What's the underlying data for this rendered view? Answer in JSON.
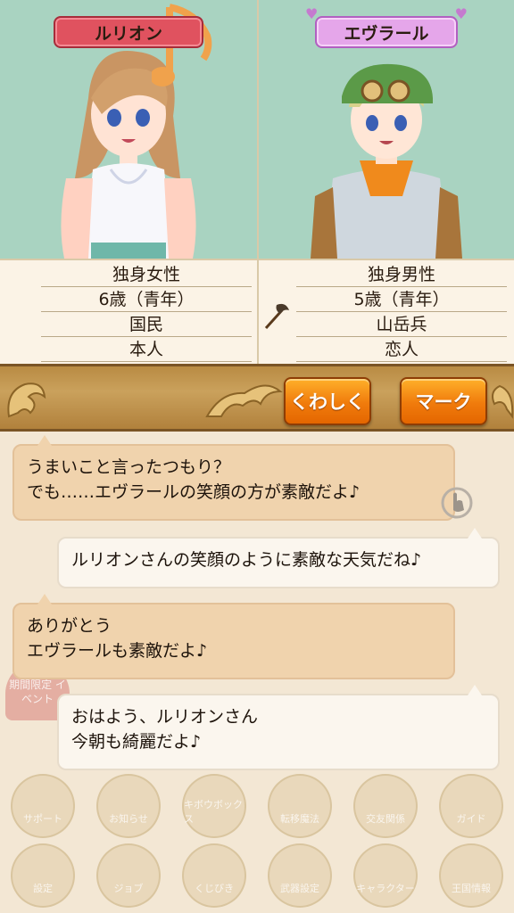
{
  "left_character": {
    "name": "ルリオン",
    "profile": [
      "独身女性",
      "6歳（青年）",
      "国民",
      "本人"
    ]
  },
  "right_character": {
    "name": "エヴラール",
    "profile": [
      "独身男性",
      "5歳（青年）",
      "山岳兵",
      "恋人"
    ]
  },
  "buttons": {
    "detail": "くわしく",
    "mark": "マーク"
  },
  "conversation": [
    {
      "line1": "うまいこと言ったつもり？",
      "line2": "でも……エヴラールの笑顔の方が素敵だよ♪"
    },
    {
      "line1": "ルリオンさんの笑顔のように素敵な天気だね♪",
      "line2": ""
    },
    {
      "line1": "ありがとう",
      "line2": "エヴラールも素敵だよ♪"
    },
    {
      "line1": "おはよう、ルリオンさん",
      "line2": "今朝も綺麗だよ♪"
    }
  ],
  "background_menu": {
    "event": "期間限定 イベント",
    "row1": [
      "サポート",
      "お知らせ",
      "キボウボックス",
      "転移魔法",
      "交友関係",
      "ガイド"
    ],
    "row2": [
      "設定",
      "ジョブ",
      "くじびき",
      "武器設定",
      "キャラクター",
      "王国情報"
    ]
  },
  "colors": {
    "female_tag": "#e0525f",
    "male_tag": "#e5a6ea",
    "button": "#f07b0c",
    "bubble_tan": "#f0d3ad",
    "bubble_white": "#fbf6ee"
  }
}
